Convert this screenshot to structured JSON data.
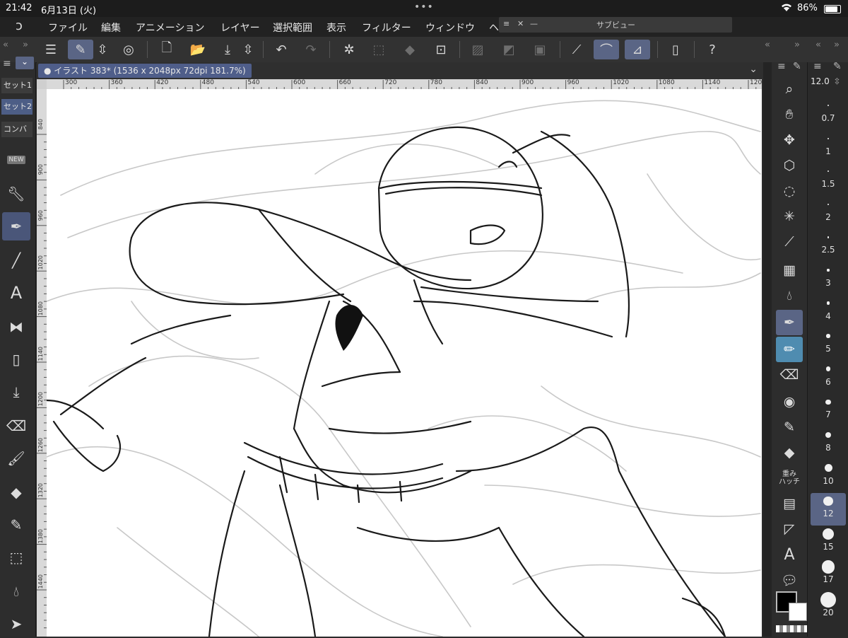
{
  "status": {
    "time": "21:42",
    "date": "6月13日 (火)",
    "battery": "86%",
    "battery_level": 0.86
  },
  "menu": {
    "items": [
      "ファイル",
      "編集",
      "アニメーション",
      "レイヤー",
      "選択範囲",
      "表示",
      "フィルター",
      "ウィンドウ",
      "ヘ"
    ]
  },
  "subview": {
    "title": "サブビュー"
  },
  "canvas": {
    "tab_title": "イラスト 383* (1536 x 2048px 72dpi 181.7%)"
  },
  "left_panel": {
    "tabs": [
      "セット1",
      "セット2",
      "コンバ"
    ],
    "new_badge": "NEW"
  },
  "rulers": {
    "top": [
      "300",
      "360",
      "420",
      "480",
      "540",
      "600",
      "660",
      "720",
      "780",
      "840",
      "900",
      "960",
      "1020",
      "1080",
      "1140",
      "1200"
    ],
    "left": [
      "840",
      "900",
      "960",
      "1020",
      "1080",
      "1140",
      "1200",
      "1260",
      "1320",
      "1380",
      "1440"
    ]
  },
  "brush_sizes": {
    "current": "12.0",
    "items": [
      "0.7",
      "1",
      "1.5",
      "2",
      "2.5",
      "3",
      "4",
      "5",
      "6",
      "7",
      "8",
      "10",
      "12",
      "15",
      "17",
      "20"
    ],
    "selected": "12"
  },
  "right_tools": {
    "weight_hatch_label": "重み\nハッチ"
  },
  "colors": {
    "accent": "#5a6585",
    "tab_accent": "#4f5e8a",
    "main_color": "#000000",
    "sub_color": "#ffffff"
  }
}
